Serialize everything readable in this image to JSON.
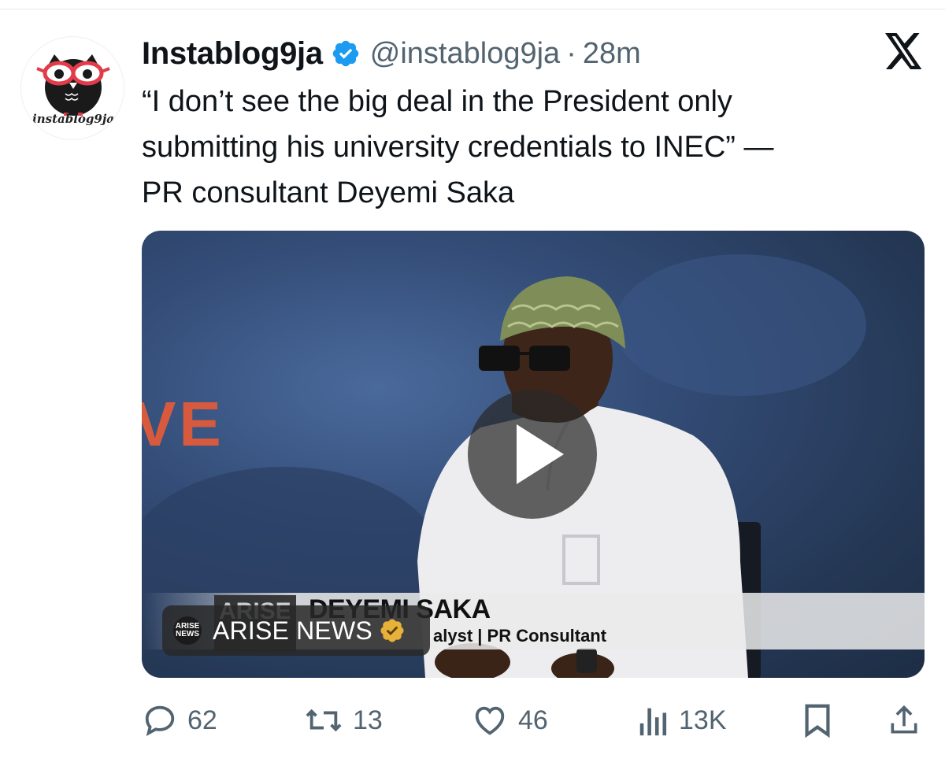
{
  "tweet": {
    "avatar_label": "instablog9ja",
    "display_name": "Instablog9ja",
    "handle": "@instablog9ja",
    "separator": "·",
    "time": "28m",
    "text_lines": [
      "“I don’t see the big deal in the President only",
      "submitting his university credentials to INEC” —",
      "PR consultant Deyemi Saka"
    ]
  },
  "media": {
    "type": "video",
    "overlay_backdrop_text": "VE",
    "lower_third_name": "DEYEMI SAKA",
    "lower_third_role": "alyst | PR Consultant",
    "lower_third_logo": "ARISE",
    "source_badge": {
      "logo_top": "ARISE",
      "logo_bottom": "NEWS",
      "label": "ARISE NEWS"
    }
  },
  "actions": {
    "replies": "62",
    "reposts": "13",
    "likes": "46",
    "views": "13K"
  },
  "colors": {
    "text_primary": "#0f1419",
    "text_secondary": "#536471",
    "verified_blue": "#1d9bf0",
    "verified_gold": "#e8b23a"
  },
  "icons": [
    "x-logo-icon",
    "verified-badge-icon",
    "play-icon",
    "reply-icon",
    "repost-icon",
    "like-icon",
    "views-icon",
    "bookmark-icon",
    "share-icon"
  ]
}
